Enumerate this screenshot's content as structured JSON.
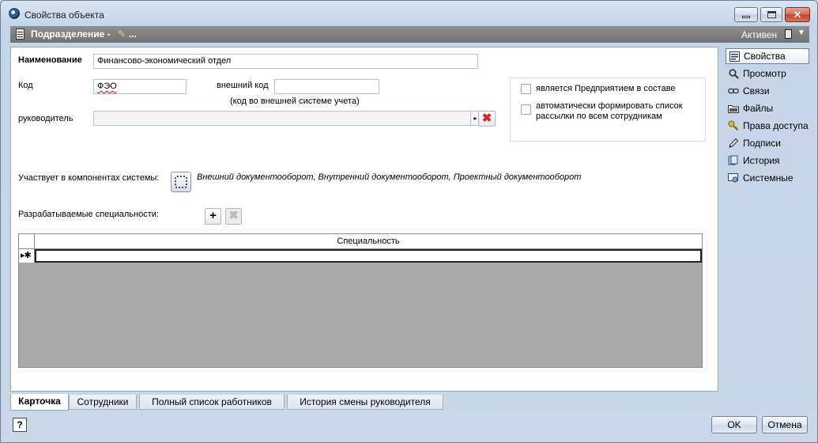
{
  "window": {
    "title": "Свойства объекта"
  },
  "header": {
    "title": "Подразделение -",
    "dots": "...",
    "status": "Активен"
  },
  "form": {
    "name_label": "Наименование",
    "name_value": "Финансово-экономический отдел",
    "code_label": "Код",
    "code_value": "ФЭО",
    "ext_code_label": "внешний код",
    "ext_code_value": "",
    "ext_code_hint": "(код во внешней системе учета)",
    "manager_label": "руководитель",
    "manager_value": "",
    "flag_enterprise": "является Предприятием в составе",
    "flag_mailing": "автоматически формировать список рассылки по всем сотрудникам",
    "components_label": "Участвует в компонентах системы:",
    "components_value": "Внешний документооборот, Внутренний документооборот, Проектный документооборот",
    "specialties_label": "Разрабатываемые специальности:",
    "add_symbol": "+",
    "remove_symbol": "✖"
  },
  "grid": {
    "column": "Специальность",
    "new_row_marker": "▸✱"
  },
  "tabs": [
    "Карточка",
    "Сотрудники",
    "Полный список работников",
    "История смены руководителя"
  ],
  "sidebar": [
    {
      "label": "Свойства",
      "icon": "properties-icon"
    },
    {
      "label": "Просмотр",
      "icon": "magnifier-icon"
    },
    {
      "label": "Связи",
      "icon": "link-icon"
    },
    {
      "label": "Файлы",
      "icon": "folder-icon"
    },
    {
      "label": "Права доступа",
      "icon": "key-icon"
    },
    {
      "label": "Подписи",
      "icon": "pen-icon"
    },
    {
      "label": "История",
      "icon": "history-icon"
    },
    {
      "label": "Системные",
      "icon": "system-icon"
    }
  ],
  "footer": {
    "help": "?",
    "ok": "OK",
    "cancel": "Отмена"
  },
  "colors": {
    "accent": "#6f849c",
    "header_bg": "#7f7f7f",
    "delete_red": "#d6261b"
  }
}
